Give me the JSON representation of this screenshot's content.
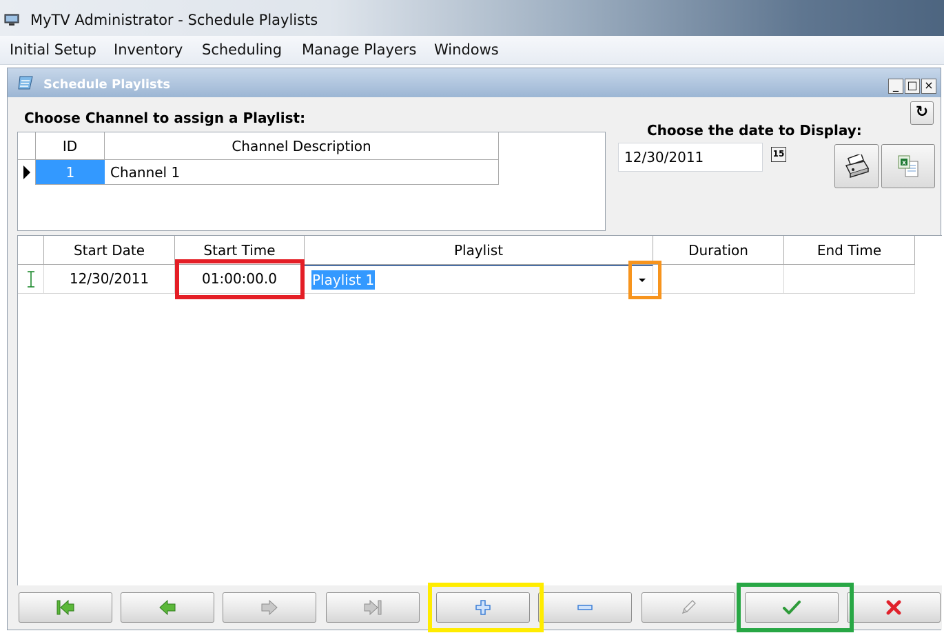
{
  "app": {
    "title": "MyTV Administrator - Schedule Playlists"
  },
  "menu": {
    "items": [
      "Initial Setup",
      "Inventory",
      "Scheduling",
      "Manage Players",
      "Windows"
    ]
  },
  "child_window": {
    "title": "Schedule Playlists",
    "controls": [
      "_",
      "□",
      "×"
    ]
  },
  "channel": {
    "label": "Choose Channel to assign a Playlist:",
    "columns": [
      "ID",
      "Channel Description"
    ],
    "rows": [
      {
        "id": "1",
        "description": "Channel 1",
        "selected": true
      }
    ]
  },
  "date": {
    "label": "Choose the date to Display:",
    "value": "12/30/2011",
    "calendar_icon_text": "15"
  },
  "schedule": {
    "columns": [
      "Start Date",
      "Start Time",
      "Playlist",
      "Duration",
      "End Time"
    ],
    "rows": [
      {
        "start_date": "12/30/2011",
        "start_time": "01:00:00.0",
        "playlist": "Playlist 1",
        "duration": "",
        "end_time": "",
        "editing": true
      }
    ]
  },
  "highlight_colors": {
    "start_time": "#e41e26",
    "dropdown": "#f7941d",
    "add_button": "#ffec00",
    "confirm_button": "#28a745"
  },
  "navigator": {
    "buttons": [
      "first",
      "previous",
      "next",
      "last",
      "add",
      "delete",
      "edit",
      "confirm",
      "cancel"
    ]
  },
  "colors": {
    "selection": "#3399ff",
    "check_green": "#2e9b3a",
    "cancel_red": "#e0212b",
    "arrow_green": "#5cb83a",
    "arrow_gray": "#8c8c8c",
    "plus_blue": "#3b7ed6"
  }
}
